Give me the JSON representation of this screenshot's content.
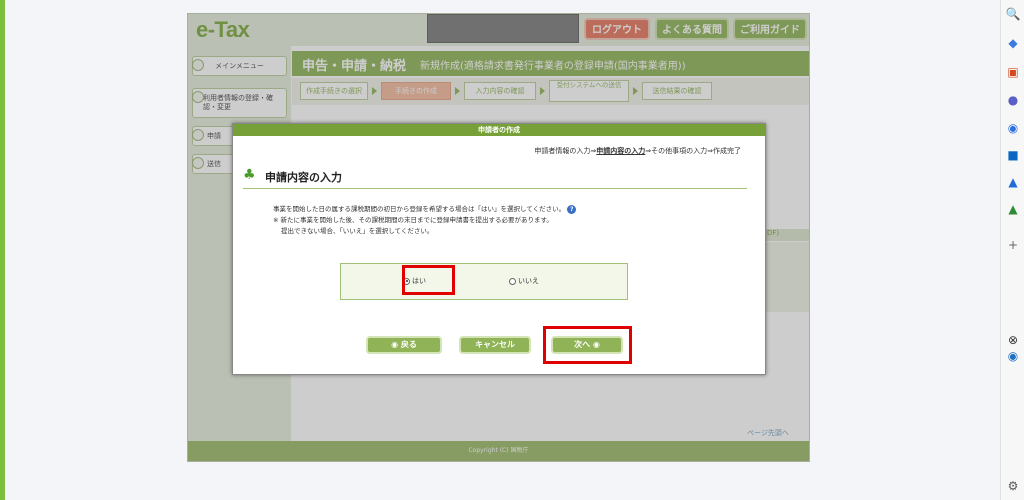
{
  "site": {
    "logo": "e-Tax",
    "header": {
      "logout": "ログアウト",
      "faq": "よくある質問",
      "guide": "ご利用ガイド"
    },
    "nav": [
      {
        "label": "メインメニュー"
      },
      {
        "label": "利用者情報の登録・確認・変更"
      },
      {
        "label": "申請"
      },
      {
        "label": "送信"
      }
    ],
    "title": {
      "main": "申告・申請・納税",
      "sub": "新規作成(適格請求書発行事業者の登録申請(国内事業者用))"
    },
    "steps": [
      {
        "label": "作成手続きの選択",
        "active": false
      },
      {
        "label": "手続きの作成",
        "active": true
      },
      {
        "label": "入力内容の確認",
        "active": false
      },
      {
        "label": "受付システムへの送信",
        "active": false
      },
      {
        "label": "送信結果の確認",
        "active": false
      }
    ],
    "pdf_tab": "DF)",
    "page_top": "ページ先頭へ",
    "footer": "Copyright (C) 国税庁"
  },
  "modal": {
    "title": "申請者の作成",
    "breadcrumb": {
      "before": "申請者情報の入力⇒",
      "current": "申請内容の入力",
      "after": "⇒その他事項の入力⇒作成完了"
    },
    "heading": "申請内容の入力",
    "desc_line1": "事業を開始した日の属する課税期間の初日から登録を希望する場合は「はい」を選択してください。",
    "desc_line2": "※ 新たに事業を開始した後、その課税期間の末日までに登録申請書を提出する必要があります。",
    "desc_line3": "提出できない場合、「いいえ」を選択してください。",
    "help_icon_text": "?",
    "radio": {
      "yes": "はい",
      "no": "いいえ",
      "selected": "yes"
    },
    "buttons": {
      "back": "◉ 戻る",
      "cancel": "キャンセル",
      "next": "次へ ◉"
    }
  },
  "colors": {
    "primary_green": "#8fb356",
    "highlight_red": "#e00000",
    "logout_orange": "#e7745b"
  }
}
